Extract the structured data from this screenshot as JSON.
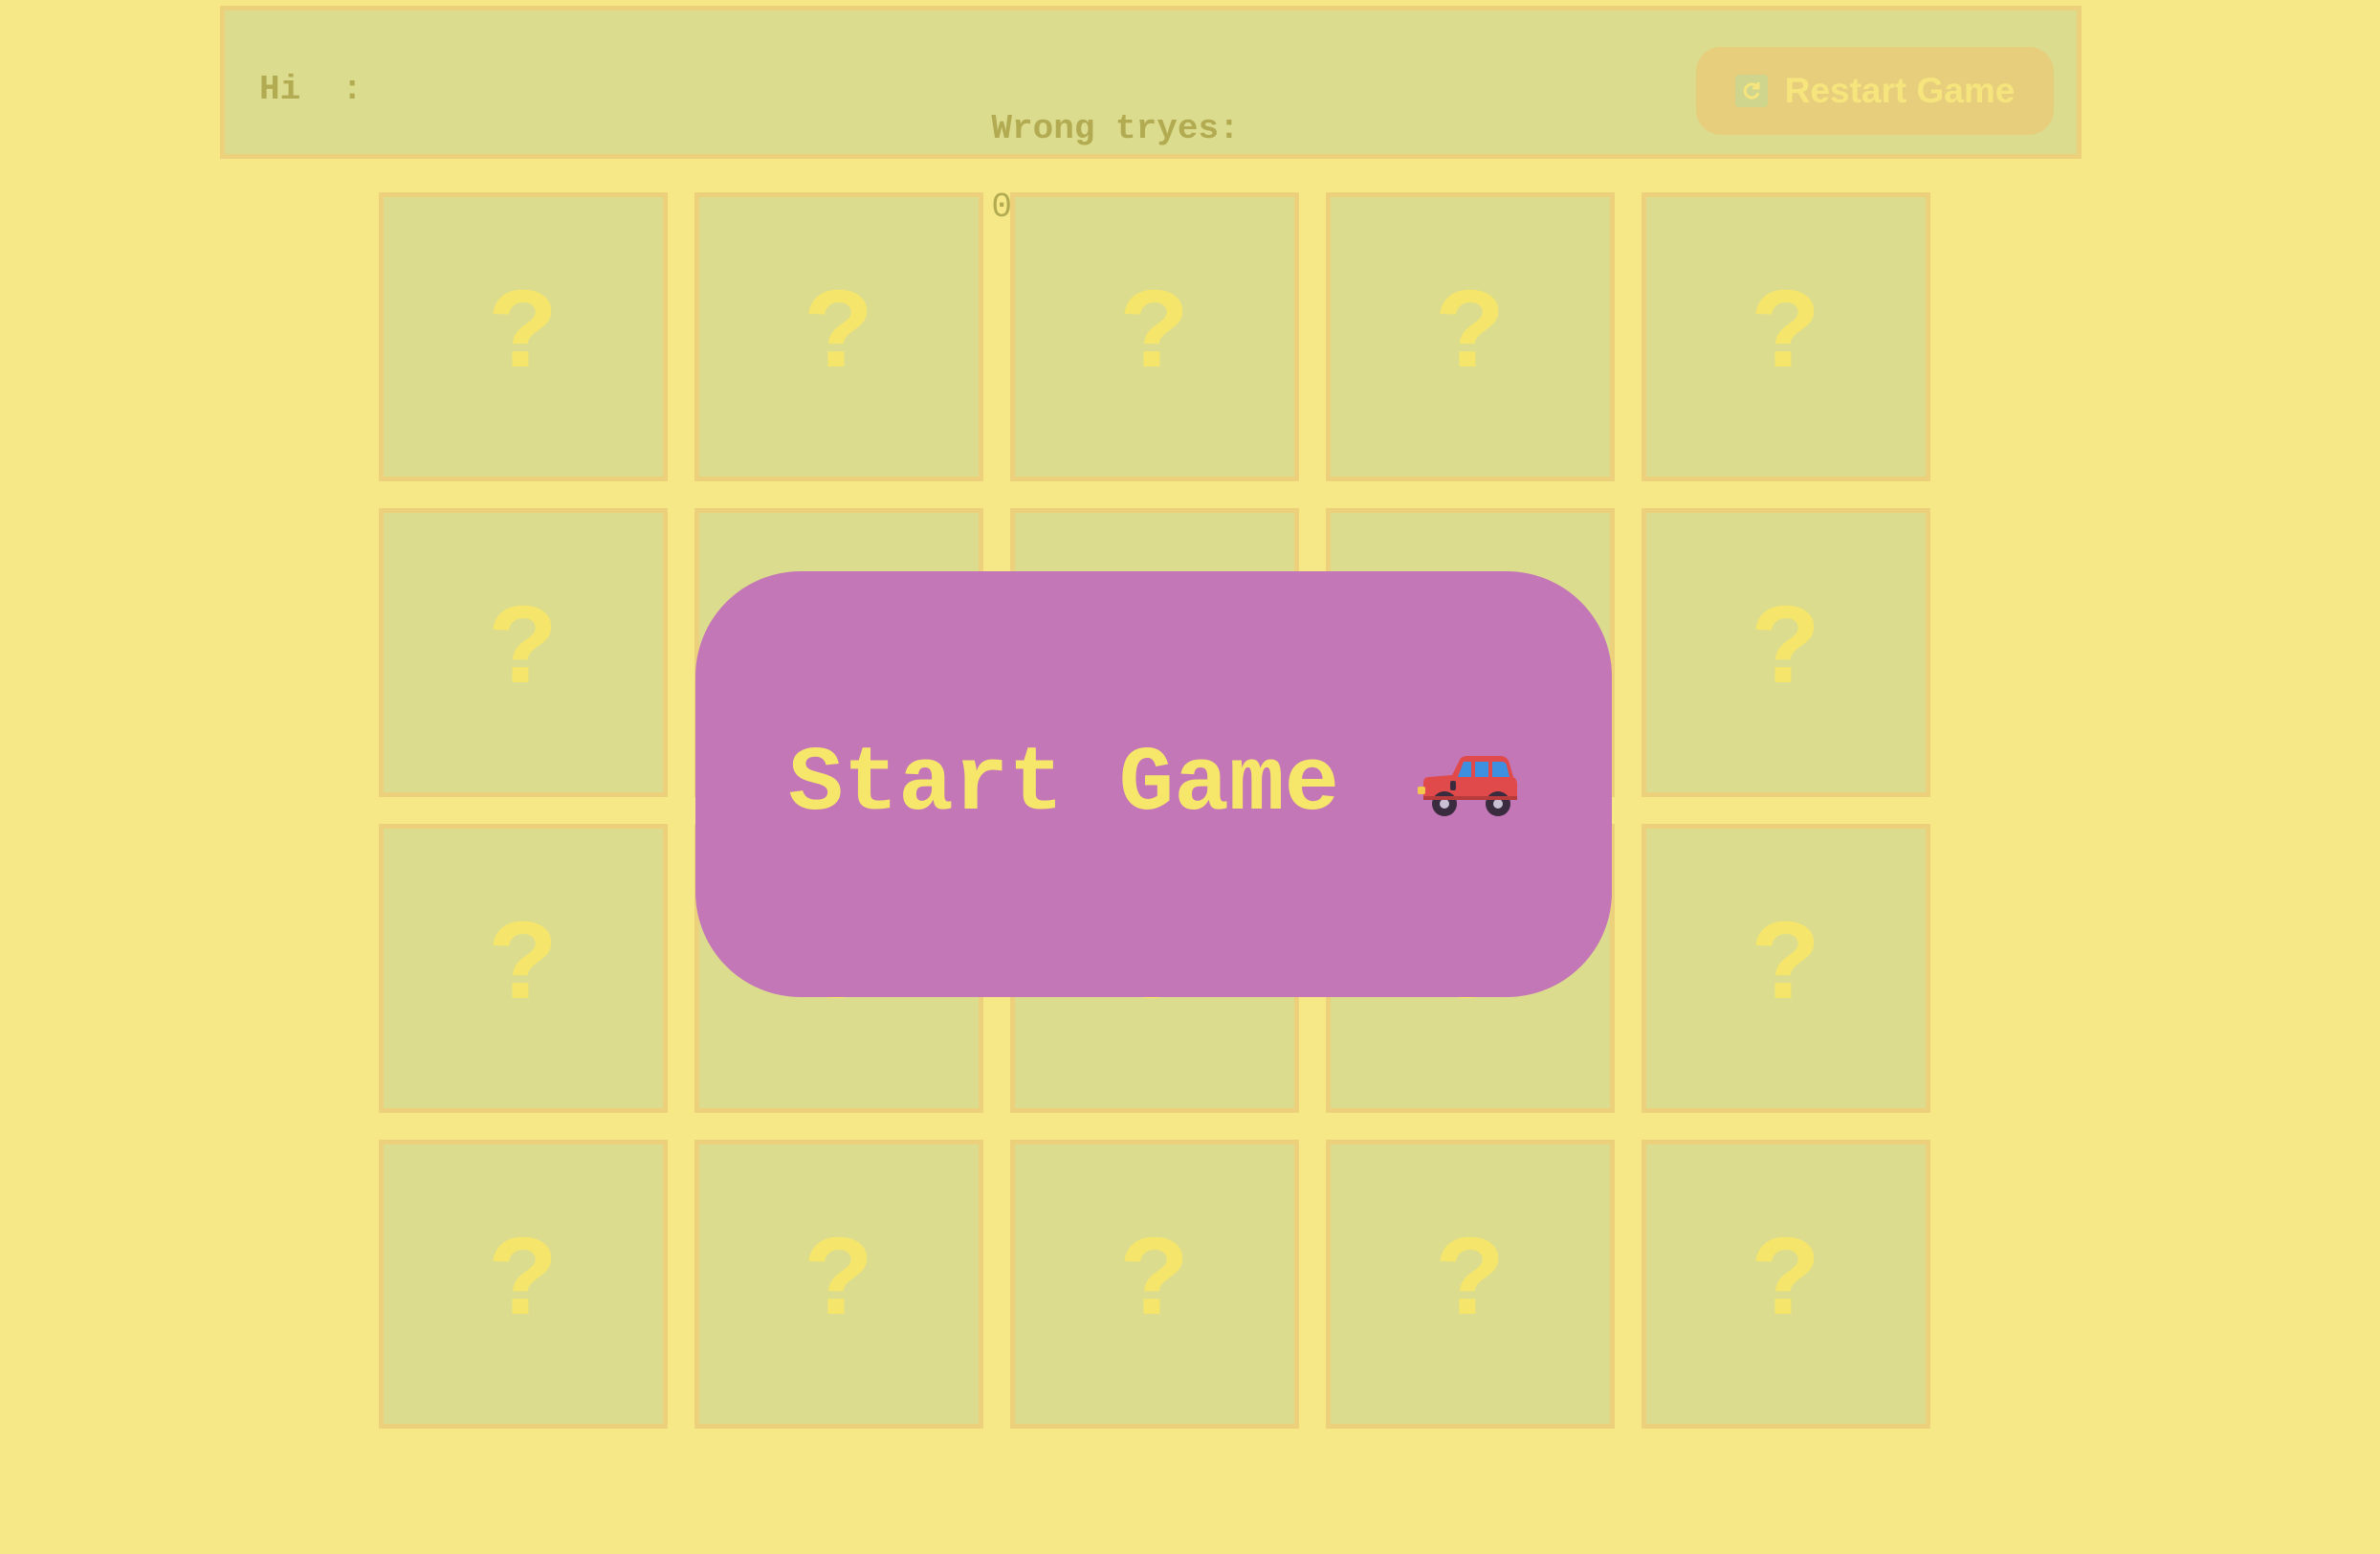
{
  "header": {
    "hi_label": "Hi  :",
    "wrong_tries_label": "Wrong tryes:",
    "wrong_tries_value": "0",
    "restart_label": "Restart Game",
    "restart_icon": "refresh-icon"
  },
  "board": {
    "cards": [
      "?",
      "?",
      "?",
      "?",
      "?",
      "?",
      "?",
      "?",
      "?",
      "?",
      "?",
      "?",
      "?",
      "?",
      "?",
      "?",
      "?",
      "?",
      "?",
      "?"
    ]
  },
  "start_overlay": {
    "label": "Start Game",
    "icon": "car-icon"
  },
  "colors": {
    "background": "#f6e887",
    "card": "#dbdc8e",
    "card_border": "#ecd07c",
    "overlay": "#c477b6",
    "accent_text": "#f6e76a"
  }
}
